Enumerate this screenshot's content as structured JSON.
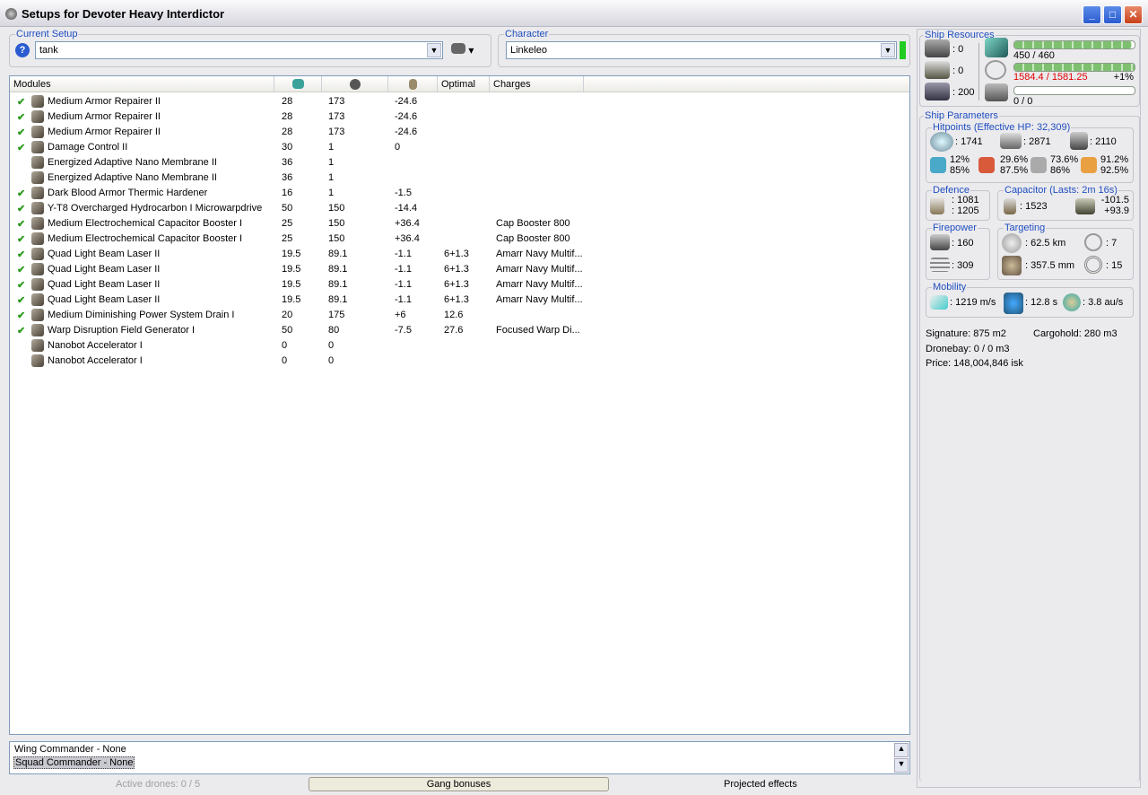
{
  "window": {
    "title": "Setups for Devoter Heavy Interdictor",
    "minimize": "_",
    "maximize": "□",
    "close": "✕"
  },
  "setup": {
    "label": "Current Setup",
    "value": "tank",
    "help": "?"
  },
  "character": {
    "label": "Character",
    "value": "Linkeleo",
    "status_color": "#22cc22"
  },
  "modules": {
    "headers": [
      "Modules",
      "",
      "",
      "",
      "Optimal",
      "Charges"
    ],
    "header_icons": [
      "cpu-icon",
      "powergrid-icon",
      "capacitor-icon"
    ],
    "rows": [
      {
        "active": true,
        "name": "Medium Armor Repairer II",
        "cpu": "28",
        "pg": "173",
        "cap": "-24.6",
        "optimal": "",
        "charges": ""
      },
      {
        "active": true,
        "name": "Medium Armor Repairer II",
        "cpu": "28",
        "pg": "173",
        "cap": "-24.6",
        "optimal": "",
        "charges": ""
      },
      {
        "active": true,
        "name": "Medium Armor Repairer II",
        "cpu": "28",
        "pg": "173",
        "cap": "-24.6",
        "optimal": "",
        "charges": ""
      },
      {
        "active": true,
        "name": "Damage Control II",
        "cpu": "30",
        "pg": "1",
        "cap": "0",
        "optimal": "",
        "charges": ""
      },
      {
        "active": false,
        "name": "Energized Adaptive Nano Membrane II",
        "cpu": "36",
        "pg": "1",
        "cap": "",
        "optimal": "",
        "charges": ""
      },
      {
        "active": false,
        "name": "Energized Adaptive Nano Membrane II",
        "cpu": "36",
        "pg": "1",
        "cap": "",
        "optimal": "",
        "charges": ""
      },
      {
        "active": true,
        "name": "Dark Blood Armor Thermic Hardener",
        "cpu": "16",
        "pg": "1",
        "cap": "-1.5",
        "optimal": "",
        "charges": ""
      },
      {
        "active": true,
        "name": "Y-T8 Overcharged Hydrocarbon I Microwarpdrive",
        "cpu": "50",
        "pg": "150",
        "cap": "-14.4",
        "optimal": "",
        "charges": ""
      },
      {
        "active": true,
        "name": "Medium Electrochemical Capacitor Booster I",
        "cpu": "25",
        "pg": "150",
        "cap": "+36.4",
        "optimal": "",
        "charges": "Cap Booster 800"
      },
      {
        "active": true,
        "name": "Medium Electrochemical Capacitor Booster I",
        "cpu": "25",
        "pg": "150",
        "cap": "+36.4",
        "optimal": "",
        "charges": "Cap Booster 800"
      },
      {
        "active": true,
        "name": "Quad Light Beam Laser II",
        "cpu": "19.5",
        "pg": "89.1",
        "cap": "-1.1",
        "optimal": "6+1.3",
        "charges": "Amarr Navy Multif..."
      },
      {
        "active": true,
        "name": "Quad Light Beam Laser II",
        "cpu": "19.5",
        "pg": "89.1",
        "cap": "-1.1",
        "optimal": "6+1.3",
        "charges": "Amarr Navy Multif..."
      },
      {
        "active": true,
        "name": "Quad Light Beam Laser II",
        "cpu": "19.5",
        "pg": "89.1",
        "cap": "-1.1",
        "optimal": "6+1.3",
        "charges": "Amarr Navy Multif..."
      },
      {
        "active": true,
        "name": "Quad Light Beam Laser II",
        "cpu": "19.5",
        "pg": "89.1",
        "cap": "-1.1",
        "optimal": "6+1.3",
        "charges": "Amarr Navy Multif..."
      },
      {
        "active": true,
        "name": "Medium Diminishing Power System Drain I",
        "cpu": "20",
        "pg": "175",
        "cap": "+6",
        "optimal": "12.6",
        "charges": ""
      },
      {
        "active": true,
        "name": "Warp Disruption Field Generator I",
        "cpu": "50",
        "pg": "80",
        "cap": "-7.5",
        "optimal": "27.6",
        "charges": "Focused Warp Di..."
      },
      {
        "active": false,
        "name": "Nanobot Accelerator I",
        "cpu": "0",
        "pg": "0",
        "cap": "",
        "optimal": "",
        "charges": ""
      },
      {
        "active": false,
        "name": "Nanobot Accelerator I",
        "cpu": "0",
        "pg": "0",
        "cap": "",
        "optimal": "",
        "charges": ""
      }
    ]
  },
  "gang": {
    "items": [
      "Wing Commander - None",
      "Squad Commander - None"
    ]
  },
  "bottom": {
    "drones": "Active drones: 0 / 5",
    "gang_bonuses": "Gang bonuses",
    "projected": "Projected effects"
  },
  "resources": {
    "label": "Ship Resources",
    "turrets": ": 0",
    "launchers": ": 0",
    "calibration": ": 200",
    "cpu": "450 / 460",
    "cpu_fraction": 0.978,
    "pg": "1584.4 / 1581.25",
    "pg_fraction": 1.0,
    "pg_over": "+1%",
    "drones": "0 / 0",
    "drone_fraction": 0,
    "overload_color": "#e00000"
  },
  "params": {
    "label": "Ship Parameters",
    "hp": {
      "label": "Hitpoints (Effective HP: 32,309)",
      "shield": ": 1741",
      "armor": ": 2871",
      "structure": ": 2110",
      "em": [
        "12%",
        "85%"
      ],
      "thermal": [
        "29.6%",
        "87.5%"
      ],
      "kinetic": [
        "73.6%",
        "86%"
      ],
      "explosive": [
        "91.2%",
        "92.5%"
      ]
    },
    "defence": {
      "label": "Defence",
      "a": ": 1081",
      "b": ": 1205"
    },
    "capacitor": {
      "label": "Capacitor (Lasts: 2m 16s)",
      "capacity": ": 1523",
      "use": "-101.5",
      "recharge": "+93.9"
    },
    "firepower": {
      "label": "Firepower",
      "volley": ": 160",
      "dps": ": 309"
    },
    "targeting": {
      "label": "Targeting",
      "range": ": 62.5 km",
      "targets": ": 7",
      "resolution": ": 357.5 mm",
      "strength": ": 15"
    },
    "mobility": {
      "label": "Mobility",
      "speed": ": 1219 m/s",
      "align": ": 12.8 s",
      "warp": ": 3.8 au/s"
    },
    "signature": "Signature: 875 m2",
    "cargo": "Cargohold: 280 m3",
    "dronebay": "Dronebay: 0 / 0 m3",
    "price": "Price: 148,004,846 isk"
  }
}
